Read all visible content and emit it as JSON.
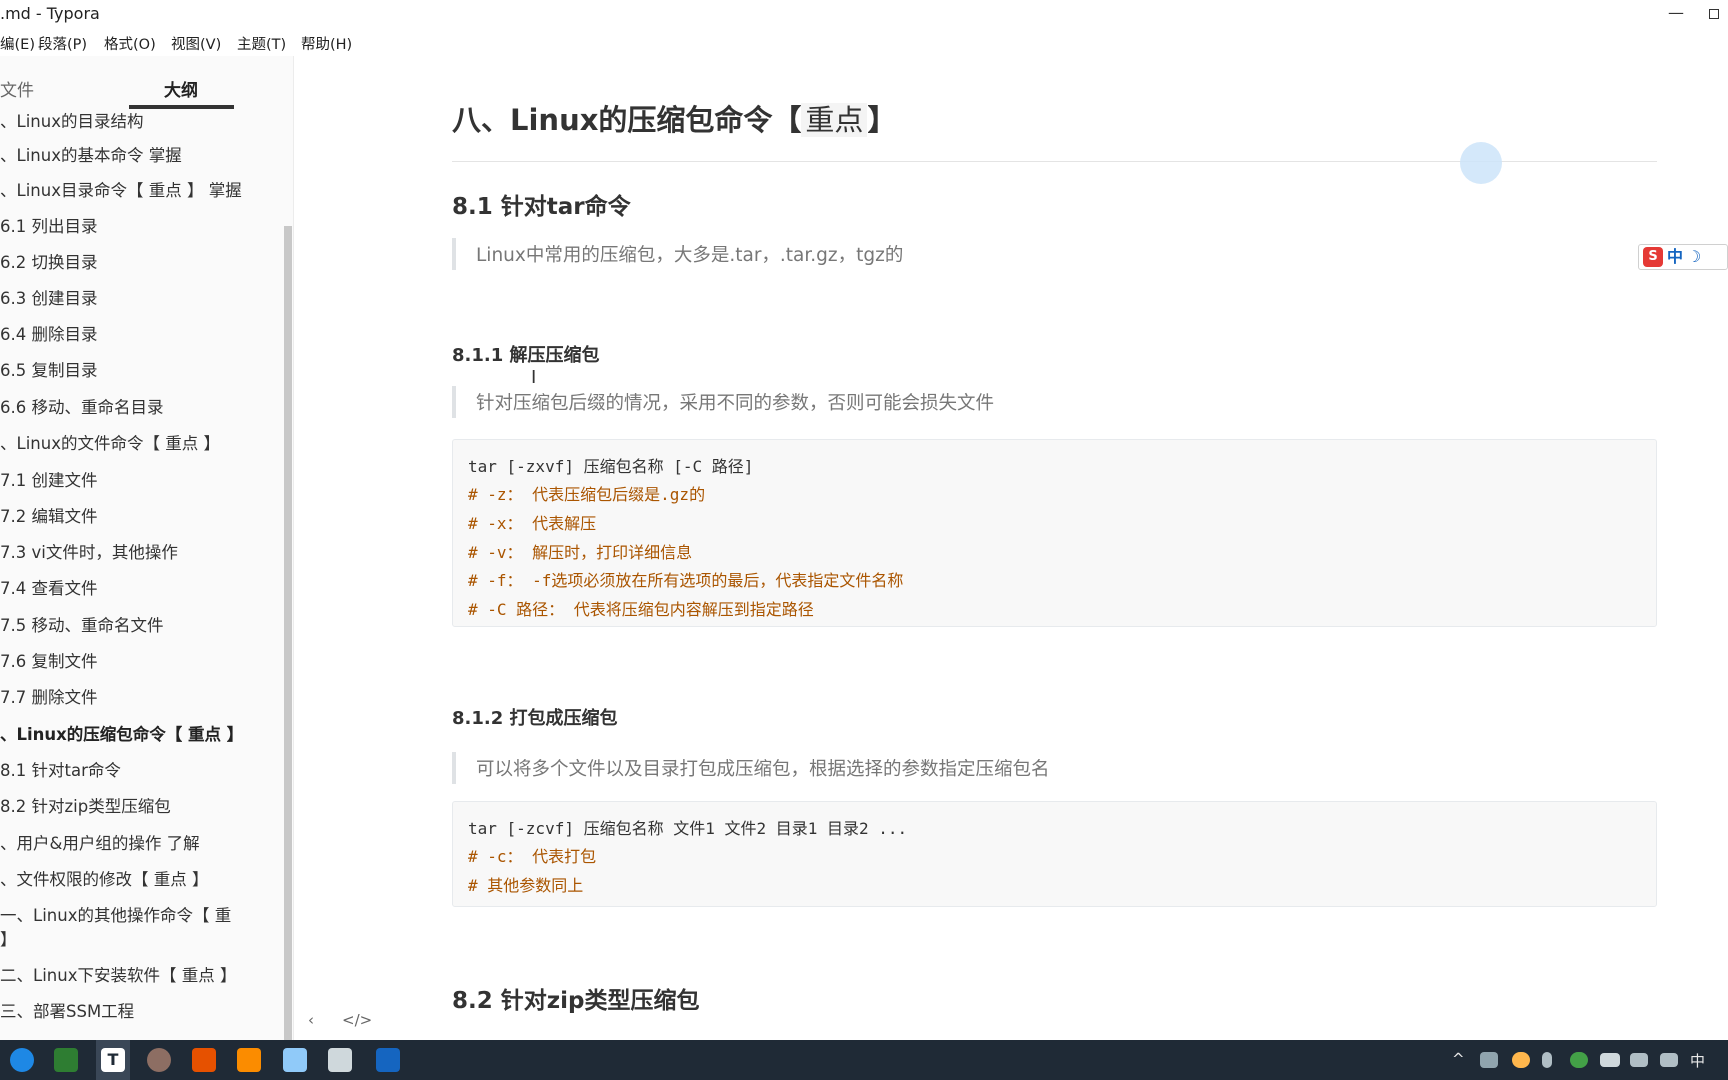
{
  "window": {
    "title": ".md - Typora",
    "minimize_label": "—"
  },
  "menu": {
    "items": [
      "编(E)",
      "段落(P)",
      "格式(O)",
      "视图(V)",
      "主题(T)",
      "帮助(H)"
    ]
  },
  "sidebar": {
    "tab_files": "文件",
    "tab_outline": "大纲",
    "outline": [
      {
        "text": "、Linux的目录结构",
        "active": false
      },
      {
        "text": "、Linux的基本命令 掌握",
        "active": false
      },
      {
        "text": "、Linux目录命令【 重点 】 掌握",
        "active": false
      },
      {
        "text": "6.1 列出目录",
        "active": false
      },
      {
        "text": "6.2 切换目录",
        "active": false
      },
      {
        "text": "6.3 创建目录",
        "active": false
      },
      {
        "text": "6.4 删除目录",
        "active": false
      },
      {
        "text": "6.5 复制目录",
        "active": false
      },
      {
        "text": "6.6 移动、重命名目录",
        "active": false
      },
      {
        "text": "、Linux的文件命令【 重点 】",
        "active": false
      },
      {
        "text": "7.1 创建文件",
        "active": false
      },
      {
        "text": "7.2 编辑文件",
        "active": false
      },
      {
        "text": "7.3 vi文件时，其他操作",
        "active": false
      },
      {
        "text": "7.4 查看文件",
        "active": false
      },
      {
        "text": "7.5 移动、重命名文件",
        "active": false
      },
      {
        "text": "7.6 复制文件",
        "active": false
      },
      {
        "text": "7.7 删除文件",
        "active": false
      },
      {
        "text": "、Linux的压缩包命令【 重点 】",
        "active": true
      },
      {
        "text": "8.1 针对tar命令",
        "active": false
      },
      {
        "text": "8.2 针对zip类型压缩包",
        "active": false
      },
      {
        "text": "、用户&用户组的操作 了解",
        "active": false
      },
      {
        "text": "、文件权限的修改【 重点 】",
        "active": false
      },
      {
        "text": "一、Linux的其他操作命令【 重",
        "active": false
      },
      {
        "text": "】",
        "active": false
      },
      {
        "text": "二、Linux下安装软件【 重点 】",
        "active": false
      },
      {
        "text": "三、部署SSM工程",
        "active": false
      }
    ],
    "back_icon": "‹",
    "source_icon": "</>"
  },
  "doc": {
    "h1": "八、Linux的压缩包命令【",
    "h1_mark": "重点",
    "h1_end": "】",
    "h2_tar": "8.1 针对tar命令",
    "quote_tar": "Linux中常用的压缩包，大多是.tar，.tar.gz，tgz的",
    "h4_extract": "8.1.1 解压压缩包",
    "quote_extract": "针对压缩包后缀的情况，采用不同的参数，否则可能会损失文件",
    "code_extract": [
      {
        "text": "tar [-zxvf] 压缩包名称 [-C 路径]",
        "comment": false
      },
      {
        "text": "# -z： 代表压缩包后缀是.gz的",
        "comment": true
      },
      {
        "text": "# -x： 代表解压",
        "comment": true
      },
      {
        "text": "# -v： 解压时，打印详细信息",
        "comment": true
      },
      {
        "text": "# -f： -f选项必须放在所有选项的最后，代表指定文件名称",
        "comment": true
      },
      {
        "text": "# -C 路径： 代表将压缩包内容解压到指定路径",
        "comment": true
      }
    ],
    "h4_pack": "8.1.2 打包成压缩包",
    "quote_pack": "可以将多个文件以及目录打包成压缩包，根据选择的参数指定压缩包名",
    "code_pack": [
      {
        "text": "tar [-zcvf] 压缩包名称 文件1 文件2 目录1 目录2 ...",
        "comment": false
      },
      {
        "text": "# -c： 代表打包",
        "comment": true
      },
      {
        "text": "# 其他参数同上",
        "comment": true
      }
    ],
    "h2_zip": "8.2 针对zip类型压缩包"
  },
  "ime": {
    "logo": "S",
    "mode": "中",
    "moon": "☽"
  },
  "taskbar": {
    "active_app_letter": "T",
    "tray_chevron": "^",
    "tray_lang": "中"
  },
  "colors": {
    "accent": "#333333",
    "code_comment": "#aa5500",
    "taskbar": "#1f2a36"
  }
}
